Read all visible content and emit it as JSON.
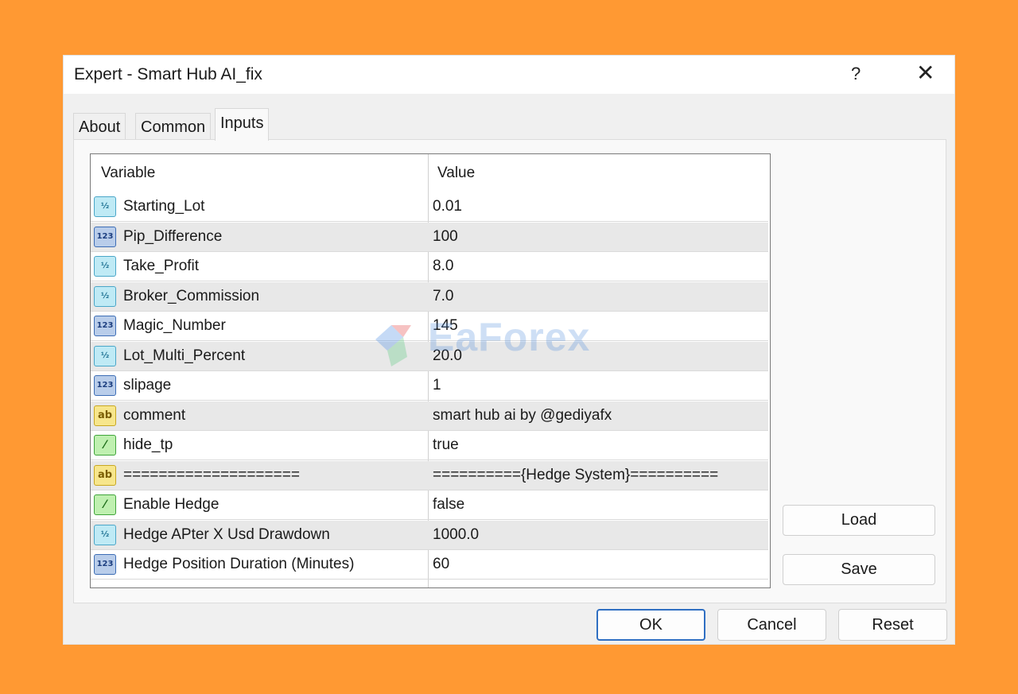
{
  "window": {
    "title": "Expert - Smart Hub AI_fix",
    "help_label": "?",
    "close_label": "✕"
  },
  "tabs": [
    {
      "label": "About"
    },
    {
      "label": "Common"
    },
    {
      "label": "Inputs"
    }
  ],
  "active_tab": "Inputs",
  "grid": {
    "columns": [
      "Variable",
      "Value"
    ],
    "rows": [
      {
        "type": "double",
        "icon": "double-type-icon",
        "icon_text": "½",
        "variable": "Starting_Lot",
        "value": "0.01"
      },
      {
        "type": "int",
        "icon": "integer-type-icon",
        "icon_text": "123",
        "variable": "Pip_Difference",
        "value": "100"
      },
      {
        "type": "double",
        "icon": "double-type-icon",
        "icon_text": "½",
        "variable": "Take_Profit",
        "value": "8.0"
      },
      {
        "type": "double",
        "icon": "double-type-icon",
        "icon_text": "½",
        "variable": "Broker_Commission",
        "value": "7.0"
      },
      {
        "type": "int",
        "icon": "integer-type-icon",
        "icon_text": "123",
        "variable": "Magic_Number",
        "value": "145"
      },
      {
        "type": "double",
        "icon": "double-type-icon",
        "icon_text": "½",
        "variable": "Lot_Multi_Percent",
        "value": "20.0"
      },
      {
        "type": "int",
        "icon": "integer-type-icon",
        "icon_text": "123",
        "variable": "slipage",
        "value": "1"
      },
      {
        "type": "string",
        "icon": "string-type-icon",
        "icon_text": "ab",
        "variable": "comment",
        "value": "smart hub ai by @gediyafx"
      },
      {
        "type": "bool",
        "icon": "boolean-type-icon",
        "icon_text": "⁄",
        "variable": "hide_tp",
        "value": "true"
      },
      {
        "type": "string",
        "icon": "string-type-icon",
        "icon_text": "ab",
        "variable": "====================",
        "value": "=========={Hedge System}=========="
      },
      {
        "type": "bool",
        "icon": "boolean-type-icon",
        "icon_text": "⁄",
        "variable": "Enable Hedge",
        "value": "false"
      },
      {
        "type": "double",
        "icon": "double-type-icon",
        "icon_text": "½",
        "variable": "Hedge APter X Usd Drawdown",
        "value": "1000.0"
      },
      {
        "type": "int",
        "icon": "integer-type-icon",
        "icon_text": "123",
        "variable": "Hedge Position Duration (Minutes)",
        "value": "60"
      }
    ]
  },
  "side_buttons": {
    "load": "Load",
    "save": "Save"
  },
  "footer_buttons": {
    "ok": "OK",
    "cancel": "Cancel",
    "reset": "Reset"
  },
  "watermark": {
    "text": "EaForex"
  },
  "colors": {
    "background": "#FF9933",
    "accent": "#2F6FC2"
  }
}
